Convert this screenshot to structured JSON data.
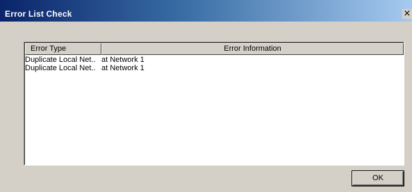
{
  "window": {
    "title": "Error List Check",
    "close_glyph": "×"
  },
  "list": {
    "columns": [
      {
        "label": "Error Type"
      },
      {
        "label": "Error Information"
      }
    ],
    "rows": [
      {
        "type": "Duplicate Local Net..",
        "info": "at Network 1"
      },
      {
        "type": "Duplicate Local Net..",
        "info": "at Network 1"
      }
    ]
  },
  "buttons": {
    "ok_label": "OK"
  }
}
